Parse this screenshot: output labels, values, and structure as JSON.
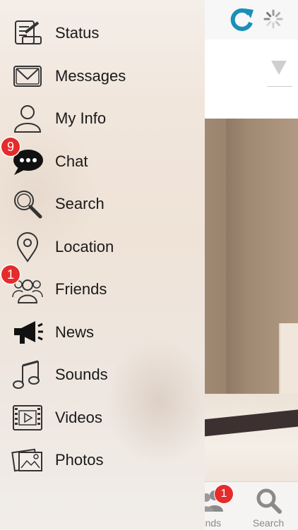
{
  "header": {
    "refresh_icon": "refresh-icon",
    "spinner_icon": "loading-spinner-icon",
    "accent": "#1a8fb8"
  },
  "filter": {
    "partial_text": "est"
  },
  "menu": {
    "items": [
      {
        "label": "Status",
        "icon": "status-edit-icon"
      },
      {
        "label": "Messages",
        "icon": "envelope-icon"
      },
      {
        "label": "My Info",
        "icon": "person-icon"
      },
      {
        "label": "Chat",
        "icon": "chat-bubble-icon",
        "badge": "9"
      },
      {
        "label": "Search",
        "icon": "magnifier-icon"
      },
      {
        "label": "Location",
        "icon": "location-pin-icon"
      },
      {
        "label": "Friends",
        "icon": "friends-icon",
        "badge": "1"
      },
      {
        "label": "News",
        "icon": "megaphone-icon"
      },
      {
        "label": "Sounds",
        "icon": "music-note-icon"
      },
      {
        "label": "Videos",
        "icon": "film-icon"
      },
      {
        "label": "Photos",
        "icon": "photos-icon"
      }
    ]
  },
  "tabbar": {
    "friends": {
      "label": "ends",
      "badge": "1"
    },
    "search": {
      "label": "Search"
    }
  },
  "colors": {
    "badge": "#e52b2b",
    "text": "#1a1a1a",
    "tab_gray": "#8a8a8a"
  }
}
